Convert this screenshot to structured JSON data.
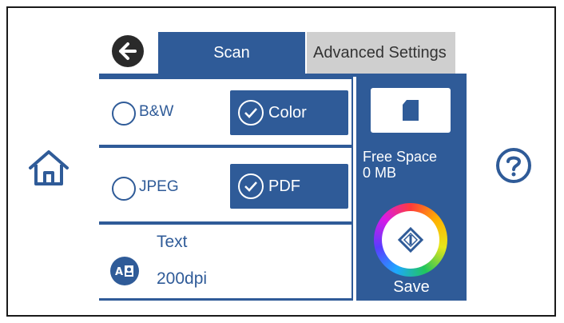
{
  "tabs": {
    "scan_label": "Scan",
    "advanced_label": "Advanced Settings"
  },
  "options": {
    "bw_label": "B&W",
    "color_label": "Color",
    "color_selected": true,
    "jpeg_label": "JPEG",
    "pdf_label": "PDF",
    "pdf_selected": true,
    "text_label": "Text",
    "dpi_label": "200dpi"
  },
  "memory": {
    "free_space_label": "Free Space",
    "free_space_value": "0 MB"
  },
  "actions": {
    "save_label": "Save"
  },
  "colors": {
    "primary": "#2f5b98",
    "tab_inactive": "#cfcfcf"
  },
  "icons": {
    "back": "back-arrow-icon",
    "home": "home-icon",
    "help": "help-icon",
    "memory_card": "memory-card-icon",
    "start": "start-diamond-icon",
    "document_type": "document-type-icon"
  }
}
